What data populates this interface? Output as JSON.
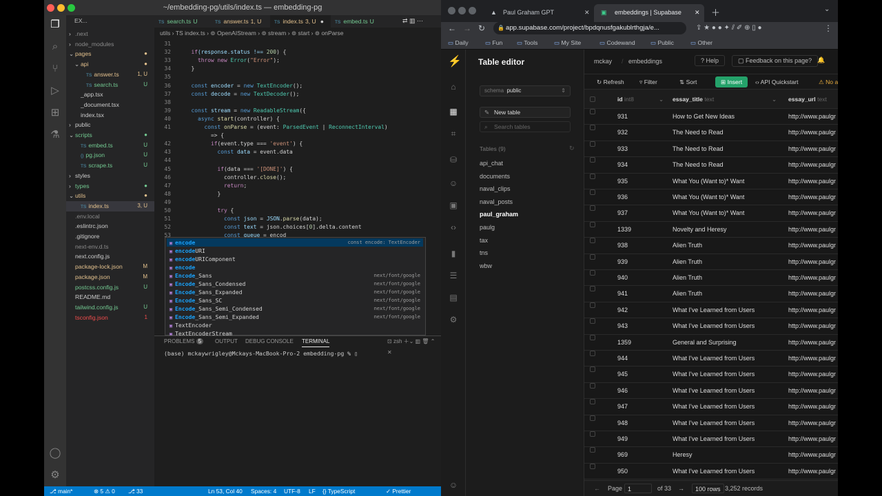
{
  "vscode": {
    "title": "~/embedding-pg/utils/index.ts — embedding-pg",
    "explorer_label": "EX...",
    "tree": [
      {
        "label": ".next",
        "arrow": "›",
        "indent": 0,
        "color": "#8a8a8a",
        "status": ""
      },
      {
        "label": "node_modules",
        "arrow": "›",
        "indent": 0,
        "color": "#8a8a8a",
        "status": ""
      },
      {
        "label": "pages",
        "arrow": "⌄",
        "indent": 0,
        "color": "#e2c08d",
        "status": "●"
      },
      {
        "label": "api",
        "arrow": "⌄",
        "indent": 1,
        "color": "#e2c08d",
        "status": "●"
      },
      {
        "label": "answer.ts",
        "arrow": "",
        "indent": 2,
        "color": "#e2c08d",
        "status": "1, U",
        "icon": "TS"
      },
      {
        "label": "search.ts",
        "arrow": "",
        "indent": 2,
        "color": "#73c991",
        "status": "U",
        "icon": "TS"
      },
      {
        "label": "_app.tsx",
        "arrow": "",
        "indent": 1,
        "color": "#cccccc",
        "status": "",
        "icon": ""
      },
      {
        "label": "_document.tsx",
        "arrow": "",
        "indent": 1,
        "color": "#cccccc",
        "status": "",
        "icon": ""
      },
      {
        "label": "index.tsx",
        "arrow": "",
        "indent": 1,
        "color": "#cccccc",
        "status": "",
        "icon": ""
      },
      {
        "label": "public",
        "arrow": "›",
        "indent": 0,
        "color": "#cccccc",
        "status": ""
      },
      {
        "label": "scripts",
        "arrow": "⌄",
        "indent": 0,
        "color": "#73c991",
        "status": "●"
      },
      {
        "label": "embed.ts",
        "arrow": "",
        "indent": 1,
        "color": "#73c991",
        "status": "U",
        "icon": "TS"
      },
      {
        "label": "pg.json",
        "arrow": "",
        "indent": 1,
        "color": "#73c991",
        "status": "U",
        "icon": "{}"
      },
      {
        "label": "scrape.ts",
        "arrow": "",
        "indent": 1,
        "color": "#73c991",
        "status": "U",
        "icon": "TS"
      },
      {
        "label": "styles",
        "arrow": "›",
        "indent": 0,
        "color": "#cccccc",
        "status": ""
      },
      {
        "label": "types",
        "arrow": "›",
        "indent": 0,
        "color": "#73c991",
        "status": "●"
      },
      {
        "label": "utils",
        "arrow": "⌄",
        "indent": 0,
        "color": "#e2c08d",
        "status": "●"
      },
      {
        "label": "index.ts",
        "arrow": "",
        "indent": 1,
        "color": "#e2c08d",
        "status": "3, U",
        "icon": "TS",
        "selected": true
      },
      {
        "label": ".env.local",
        "arrow": "",
        "indent": 0,
        "color": "#8a8a8a",
        "status": "",
        "icon": ""
      },
      {
        "label": ".eslintrc.json",
        "arrow": "",
        "indent": 0,
        "color": "#cccccc",
        "status": "",
        "icon": ""
      },
      {
        "label": ".gitignore",
        "arrow": "",
        "indent": 0,
        "color": "#cccccc",
        "status": "",
        "icon": ""
      },
      {
        "label": "next-env.d.ts",
        "arrow": "",
        "indent": 0,
        "color": "#8a8a8a",
        "status": "",
        "icon": ""
      },
      {
        "label": "next.config.js",
        "arrow": "",
        "indent": 0,
        "color": "#cccccc",
        "status": "",
        "icon": ""
      },
      {
        "label": "package-lock.json",
        "arrow": "",
        "indent": 0,
        "color": "#e2c08d",
        "status": "M",
        "icon": ""
      },
      {
        "label": "package.json",
        "arrow": "",
        "indent": 0,
        "color": "#e2c08d",
        "status": "M",
        "icon": ""
      },
      {
        "label": "postcss.config.js",
        "arrow": "",
        "indent": 0,
        "color": "#73c991",
        "status": "U",
        "icon": ""
      },
      {
        "label": "README.md",
        "arrow": "",
        "indent": 0,
        "color": "#cccccc",
        "status": "",
        "icon": ""
      },
      {
        "label": "tailwind.config.js",
        "arrow": "",
        "indent": 0,
        "color": "#73c991",
        "status": "U",
        "icon": ""
      },
      {
        "label": "tsconfig.json",
        "arrow": "",
        "indent": 0,
        "color": "#f14c4c",
        "status": "1",
        "icon": ""
      }
    ],
    "tabs": [
      {
        "label": "search.ts",
        "suffix": "U",
        "color": "#73c991"
      },
      {
        "label": "answer.ts",
        "suffix": "1, U",
        "color": "#e2c08d"
      },
      {
        "label": "index.ts",
        "suffix": "3, U",
        "color": "#e2c08d",
        "active": true
      },
      {
        "label": "embed.ts",
        "suffix": "U",
        "color": "#73c991"
      }
    ],
    "breadcrumb": "utils  ›  TS index.ts  ›  ⊚ OpenAIStream  ›  ⊚ stream  ›  ⊚ start  ›  ⊚ onParse",
    "code": [
      {
        "n": "31",
        "text": ""
      },
      {
        "n": "32",
        "segs": [
          [
            "  ",
            ""
          ],
          [
            "if",
            "c"
          ],
          [
            "(response.status !== ",
            "v"
          ],
          [
            "200",
            "n"
          ],
          [
            ") {",
            ""
          ]
        ]
      },
      {
        "n": "33",
        "segs": [
          [
            "    ",
            ""
          ],
          [
            "throw new ",
            "c"
          ],
          [
            "Error",
            "t"
          ],
          [
            "(",
            ""
          ],
          [
            "\"Error\"",
            "s"
          ],
          [
            ");",
            ""
          ]
        ]
      },
      {
        "n": "34",
        "segs": [
          [
            "  }",
            ""
          ]
        ]
      },
      {
        "n": "35",
        "text": ""
      },
      {
        "n": "36",
        "segs": [
          [
            "  ",
            ""
          ],
          [
            "const ",
            "k"
          ],
          [
            "encoder",
            "v"
          ],
          [
            " = ",
            ""
          ],
          [
            "new ",
            "k"
          ],
          [
            "TextEncoder",
            "t"
          ],
          [
            "();",
            ""
          ]
        ]
      },
      {
        "n": "37",
        "segs": [
          [
            "  ",
            ""
          ],
          [
            "const ",
            "k"
          ],
          [
            "decode",
            "v"
          ],
          [
            " = ",
            ""
          ],
          [
            "new ",
            "k"
          ],
          [
            "TextDecoder",
            "t"
          ],
          [
            "();",
            ""
          ]
        ]
      },
      {
        "n": "38",
        "text": ""
      },
      {
        "n": "39",
        "segs": [
          [
            "  ",
            ""
          ],
          [
            "const ",
            "k"
          ],
          [
            "stream",
            "v"
          ],
          [
            " = ",
            ""
          ],
          [
            "new ",
            "k"
          ],
          [
            "ReadableStream",
            "t"
          ],
          [
            "({",
            ""
          ]
        ]
      },
      {
        "n": "40",
        "segs": [
          [
            "    ",
            ""
          ],
          [
            "async ",
            "k"
          ],
          [
            "start",
            "f"
          ],
          [
            "(controller) {",
            ""
          ]
        ]
      },
      {
        "n": "41",
        "segs": [
          [
            "      ",
            ""
          ],
          [
            "const ",
            "k"
          ],
          [
            "onParse",
            "f"
          ],
          [
            " = (event: ",
            ""
          ],
          [
            "ParsedEvent",
            "t"
          ],
          [
            " | ",
            ""
          ],
          [
            "ReconnectInterval",
            "t"
          ],
          [
            ")",
            ""
          ]
        ]
      },
      {
        "n": "",
        "segs": [
          [
            "        => {",
            ""
          ]
        ]
      },
      {
        "n": "42",
        "segs": [
          [
            "        ",
            ""
          ],
          [
            "if",
            "c"
          ],
          [
            "(event.type === ",
            ""
          ],
          [
            "'event'",
            "s"
          ],
          [
            ") {",
            ""
          ]
        ]
      },
      {
        "n": "43",
        "segs": [
          [
            "          ",
            ""
          ],
          [
            "const ",
            "k"
          ],
          [
            "data",
            "v"
          ],
          [
            " = event.data",
            ""
          ]
        ]
      },
      {
        "n": "44",
        "text": ""
      },
      {
        "n": "45",
        "segs": [
          [
            "          ",
            ""
          ],
          [
            "if",
            "c"
          ],
          [
            "(data === ",
            ""
          ],
          [
            "'[DONE]'",
            "s"
          ],
          [
            ") {",
            ""
          ]
        ]
      },
      {
        "n": "46",
        "segs": [
          [
            "            controller.",
            ""
          ],
          [
            "close",
            "f"
          ],
          [
            "();",
            ""
          ]
        ]
      },
      {
        "n": "47",
        "segs": [
          [
            "            ",
            ""
          ],
          [
            "return",
            "c"
          ],
          [
            ";",
            ""
          ]
        ]
      },
      {
        "n": "48",
        "segs": [
          [
            "          }",
            ""
          ]
        ]
      },
      {
        "n": "49",
        "text": ""
      },
      {
        "n": "50",
        "segs": [
          [
            "          ",
            ""
          ],
          [
            "try",
            "c"
          ],
          [
            " {",
            ""
          ]
        ]
      },
      {
        "n": "51",
        "segs": [
          [
            "            ",
            ""
          ],
          [
            "const ",
            "k"
          ],
          [
            "json",
            "v"
          ],
          [
            " = ",
            ""
          ],
          [
            "JSON",
            "v"
          ],
          [
            ".",
            ""
          ],
          [
            "parse",
            "f"
          ],
          [
            "(data);",
            ""
          ]
        ]
      },
      {
        "n": "52",
        "segs": [
          [
            "            ",
            ""
          ],
          [
            "const ",
            "k"
          ],
          [
            "text",
            "v"
          ],
          [
            " = json.choices[",
            ""
          ],
          [
            "0",
            "n"
          ],
          [
            "].delta.content",
            ""
          ]
        ]
      },
      {
        "n": "53",
        "segs": [
          [
            "            ",
            ""
          ],
          [
            "const ",
            "k"
          ],
          [
            "queue",
            "v"
          ],
          [
            " = encod",
            ""
          ]
        ]
      }
    ],
    "suggestions": [
      {
        "hl": "encode",
        "rest": "",
        "detail": "const encode: TextEncoder"
      },
      {
        "hl": "encode",
        "rest": "URI",
        "detail": ""
      },
      {
        "hl": "encode",
        "rest": "URIComponent",
        "detail": ""
      },
      {
        "hl": "encode",
        "rest": "",
        "detail": ""
      },
      {
        "hl": "Encode",
        "rest": "_Sans",
        "detail": "next/font/google"
      },
      {
        "hl": "Encode",
        "rest": "_Sans_Condensed",
        "detail": "next/font/google"
      },
      {
        "hl": "Encode",
        "rest": "_Sans_Expanded",
        "detail": "next/font/google"
      },
      {
        "hl": "Encode",
        "rest": "_Sans_SC",
        "detail": "next/font/google"
      },
      {
        "hl": "Encode",
        "rest": "_Sans_Semi_Condensed",
        "detail": "next/font/google"
      },
      {
        "hl": "Encode",
        "rest": "_Sans_Semi_Expanded",
        "detail": "next/font/google"
      },
      {
        "hl": "",
        "rest": "TextEncoder",
        "detail": ""
      },
      {
        "hl": "",
        "rest": "TextEncoderStream",
        "detail": ""
      }
    ],
    "panel_tabs": {
      "problems": "PROBLEMS",
      "problems_count": "5",
      "output": "OUTPUT",
      "debug": "DEBUG CONSOLE",
      "terminal": "TERMINAL",
      "shell": "zsh"
    },
    "terminal_line": "(base) mckaywrigley@Mckays-MacBook-Pro-2 embedding-pg % ▯",
    "status": {
      "branch": "main*",
      "errors": "⊗ 5 ⚠ 0",
      "lineinfo": "Ln 53, Col 40",
      "spaces": "Spaces: 4",
      "enc": "UTF-8",
      "eol": "LF",
      "lang": "{} TypeScript",
      "prettier": "✓ Prettier",
      "extra": "⎇ 33"
    }
  },
  "chrome": {
    "tabs": [
      {
        "label": "Paul Graham GPT"
      },
      {
        "label": "embeddings | Supabase",
        "active": true
      }
    ],
    "url": "app.supabase.com/project/bpdqnusfgakublrthgja/e...",
    "bookmarks": [
      "Daily",
      "Fun",
      "Tools",
      "My Site",
      "Codewand",
      "Public",
      "Other"
    ],
    "supabase": {
      "title": "Table editor",
      "project": "mckay",
      "table_crumb": "embeddings",
      "help": "Help",
      "feedback": "Feedback on this page?",
      "schema_label": "schema",
      "schema_value": "public",
      "new_table": "New table",
      "search_placeholder": "Search tables",
      "tables_header": "Tables (9)",
      "tables": [
        "api_chat",
        "documents",
        "naval_clips",
        "naval_posts",
        "paul_graham",
        "paulg",
        "tax",
        "tns",
        "wbw"
      ],
      "active_table": "paul_graham",
      "toolbar": {
        "refresh": "Refresh",
        "filter": "Filter",
        "sort": "Sort",
        "insert": "Insert",
        "quickstart": "API Quickstart",
        "noauth": "No a"
      },
      "columns": [
        {
          "name": "id",
          "type": "int8"
        },
        {
          "name": "essay_title",
          "type": "text"
        },
        {
          "name": "essay_url",
          "type": "text"
        }
      ],
      "rows": [
        [
          "931",
          "How to Get New Ideas",
          "http://www.paulgr"
        ],
        [
          "932",
          "The Need to Read",
          "http://www.paulgr"
        ],
        [
          "933",
          "The Need to Read",
          "http://www.paulgr"
        ],
        [
          "934",
          "The Need to Read",
          "http://www.paulgr"
        ],
        [
          "935",
          "What You (Want to)* Want",
          "http://www.paulgr"
        ],
        [
          "936",
          "What You (Want to)* Want",
          "http://www.paulgr"
        ],
        [
          "937",
          "What You (Want to)* Want",
          "http://www.paulgr"
        ],
        [
          "1339",
          "Novelty and Heresy",
          "http://www.paulgr"
        ],
        [
          "938",
          "Alien Truth",
          "http://www.paulgr"
        ],
        [
          "939",
          "Alien Truth",
          "http://www.paulgr"
        ],
        [
          "940",
          "Alien Truth",
          "http://www.paulgr"
        ],
        [
          "941",
          "Alien Truth",
          "http://www.paulgr"
        ],
        [
          "942",
          "What I've Learned from Users",
          "http://www.paulgr"
        ],
        [
          "943",
          "What I've Learned from Users",
          "http://www.paulgr"
        ],
        [
          "1359",
          "General and Surprising",
          "http://www.paulgr"
        ],
        [
          "944",
          "What I've Learned from Users",
          "http://www.paulgr"
        ],
        [
          "945",
          "What I've Learned from Users",
          "http://www.paulgr"
        ],
        [
          "946",
          "What I've Learned from Users",
          "http://www.paulgr"
        ],
        [
          "947",
          "What I've Learned from Users",
          "http://www.paulgr"
        ],
        [
          "948",
          "What I've Learned from Users",
          "http://www.paulgr"
        ],
        [
          "949",
          "What I've Learned from Users",
          "http://www.paulgr"
        ],
        [
          "969",
          "Heresy",
          "http://www.paulgr"
        ],
        [
          "950",
          "What I've Learned from Users",
          "http://www.paulgr"
        ]
      ],
      "footer": {
        "page_label": "Page",
        "page": "1",
        "of": "of 33",
        "rows": "100 rows",
        "records": "3,252 records"
      }
    }
  },
  "colors": {
    "accent": "#007acc",
    "supabase_green": "#3ecf8e",
    "insert_bg": "#24a26a"
  }
}
